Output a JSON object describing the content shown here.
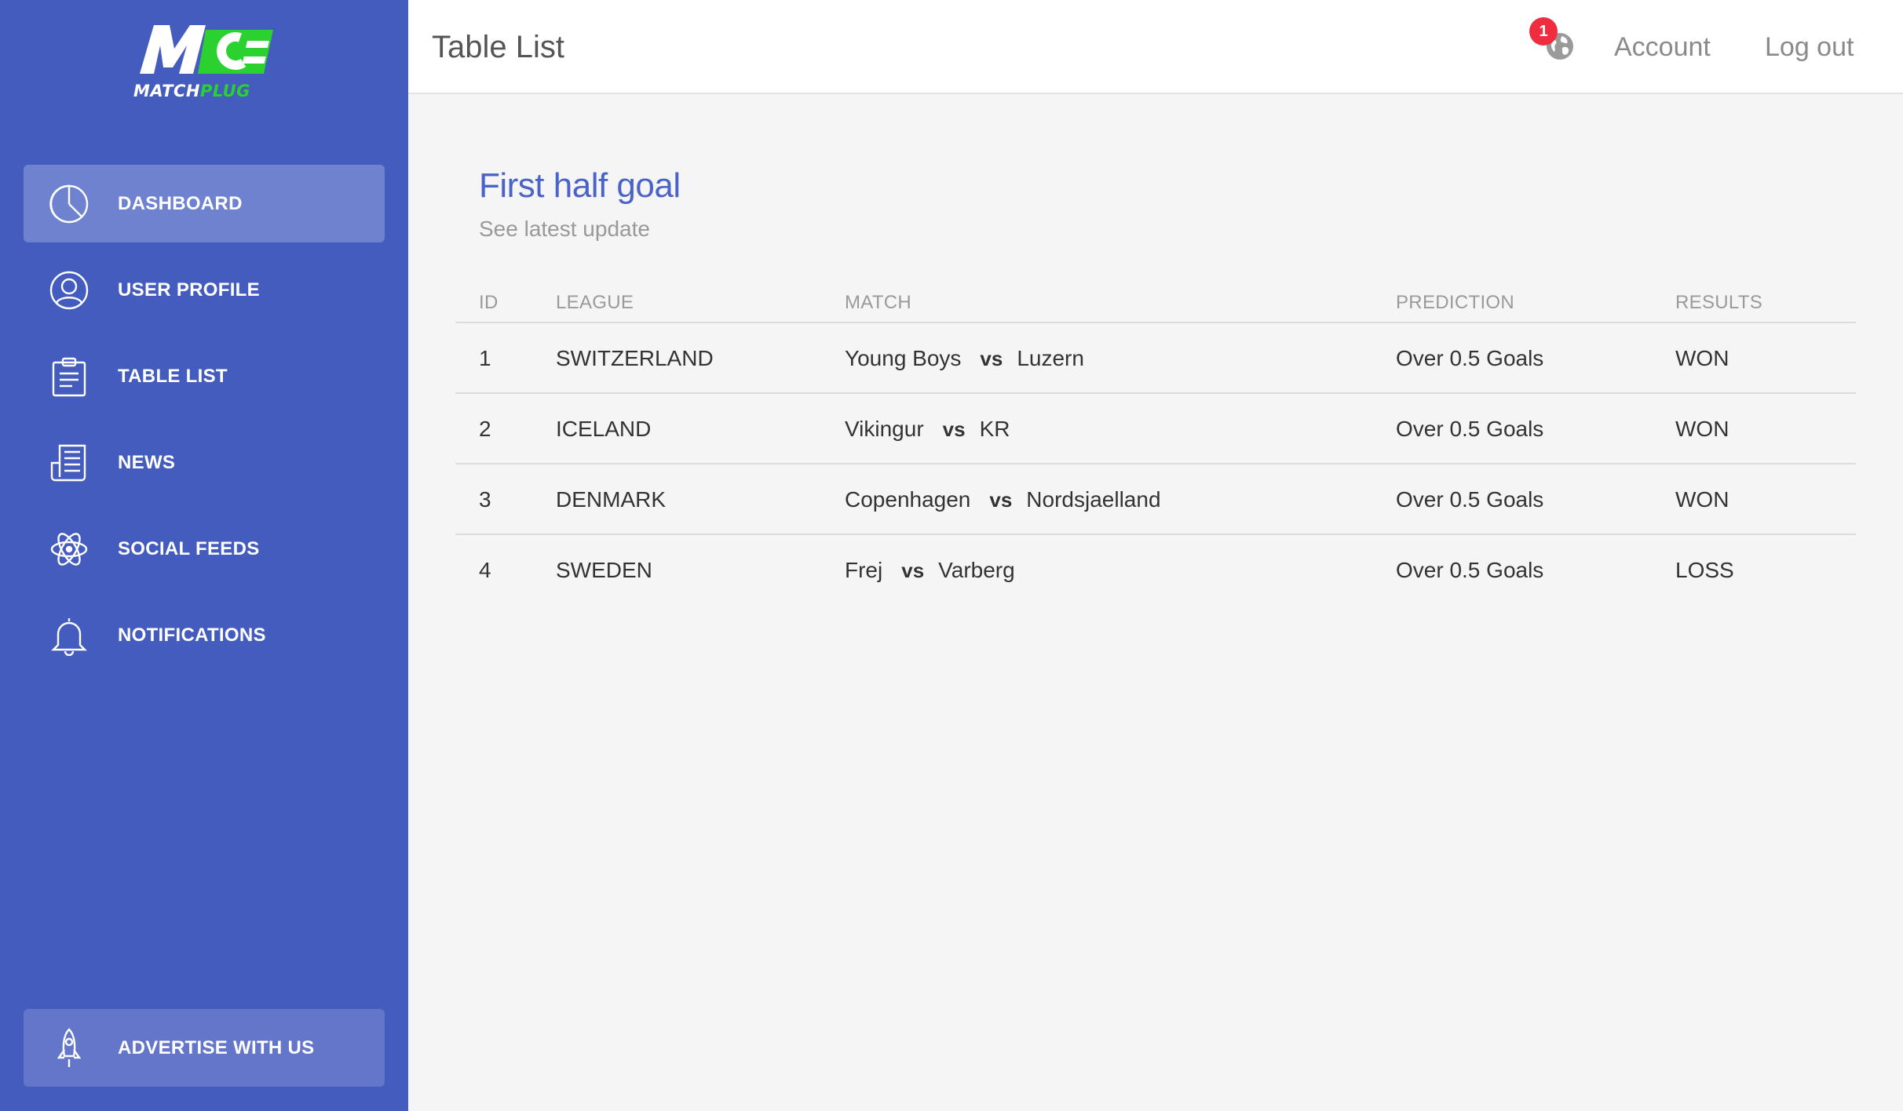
{
  "brand": {
    "logo_word_white": "MATCH",
    "logo_word_green": "PLUG",
    "primary_color": "#435cbd",
    "accent_green": "#2ad12f"
  },
  "sidebar": {
    "items": [
      {
        "label": "DASHBOARD",
        "icon": "pie-chart-icon",
        "active": true
      },
      {
        "label": "USER PROFILE",
        "icon": "user-icon"
      },
      {
        "label": "TABLE LIST",
        "icon": "clipboard-icon"
      },
      {
        "label": "NEWS",
        "icon": "newspaper-icon"
      },
      {
        "label": "SOCIAL FEEDS",
        "icon": "atom-icon"
      },
      {
        "label": "NOTIFICATIONS",
        "icon": "bell-icon"
      }
    ],
    "advertise": {
      "label": "ADVERTISE WITH US",
      "icon": "rocket-icon"
    }
  },
  "header": {
    "title": "Table List",
    "notification_count": "1",
    "account_label": "Account",
    "logout_label": "Log out"
  },
  "card": {
    "title": "First half goal",
    "subtitle": "See latest update"
  },
  "table": {
    "columns": [
      "ID",
      "LEAGUE",
      "MATCH",
      "PREDICTION",
      "RESULTS"
    ],
    "vs_label": "vs",
    "rows": [
      {
        "id": "1",
        "league": "SWITZERLAND",
        "home": "Young Boys",
        "away": "Luzern",
        "prediction": "Over 0.5 Goals",
        "result": "WON"
      },
      {
        "id": "2",
        "league": "ICELAND",
        "home": "Vikingur",
        "away": "KR",
        "prediction": "Over 0.5 Goals",
        "result": "WON"
      },
      {
        "id": "3",
        "league": "DENMARK",
        "home": "Copenhagen",
        "away": "Nordsjaelland",
        "prediction": "Over 0.5 Goals",
        "result": "WON"
      },
      {
        "id": "4",
        "league": "SWEDEN",
        "home": "Frej",
        "away": "Varberg",
        "prediction": "Over 0.5 Goals",
        "result": "LOSS"
      }
    ]
  }
}
